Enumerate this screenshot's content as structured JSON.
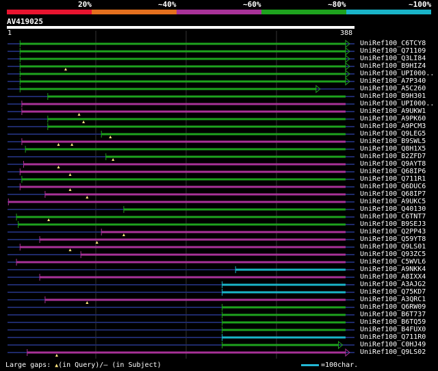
{
  "legend": {
    "labels": [
      "20%",
      "~40%",
      "~60%",
      "~80%",
      "~100%"
    ],
    "colors": [
      "#e8142f",
      "#e36f1e",
      "#a83298",
      "#1ea21e",
      "#1ab4c8"
    ]
  },
  "query": {
    "id": "AV419025",
    "start_label": "1",
    "end_label": "388",
    "length": 388
  },
  "colors": {
    "identity_40_60": "#a83298",
    "identity_60_80": "#1ea21e",
    "identity_80_100": "#1ab4c8",
    "unaligned": "#1e2a6a",
    "gap_marker": "#ffe680",
    "grid": "#333333"
  },
  "hits": [
    {
      "name": "UniRef100_C6TCY8",
      "start": 14,
      "end": 378,
      "color": "green",
      "arrow": true,
      "gaps": []
    },
    {
      "name": "UniRef100_Q71109",
      "start": 14,
      "end": 378,
      "color": "green",
      "arrow": true,
      "gaps": []
    },
    {
      "name": "UniRef100_Q3LI84",
      "start": 14,
      "end": 378,
      "color": "green",
      "arrow": true,
      "gaps": []
    },
    {
      "name": "UniRef100_B9HIZ4",
      "start": 14,
      "end": 378,
      "color": "green",
      "arrow": true,
      "gaps": [
        65
      ]
    },
    {
      "name": "UniRef100_UPI000..",
      "start": 14,
      "end": 378,
      "color": "green",
      "arrow": true,
      "gaps": []
    },
    {
      "name": "UniRef100_A7P340",
      "start": 14,
      "end": 378,
      "color": "green",
      "arrow": true,
      "gaps": []
    },
    {
      "name": "UniRef100_A5C260",
      "start": 14,
      "end": 345,
      "color": "green",
      "arrow": true,
      "gaps": []
    },
    {
      "name": "UniRef100_B9H301",
      "start": 45,
      "end": 378,
      "color": "green",
      "arrow": false,
      "gaps": []
    },
    {
      "name": "UniRef100_UPI000..",
      "start": 16,
      "end": 378,
      "color": "purple",
      "arrow": false,
      "gaps": []
    },
    {
      "name": "UniRef100_A9UKW1",
      "start": 16,
      "end": 378,
      "color": "purple",
      "arrow": false,
      "gaps": [
        80
      ]
    },
    {
      "name": "UniRef100_A9PK60",
      "start": 45,
      "end": 378,
      "color": "green",
      "arrow": false,
      "gaps": [
        85
      ]
    },
    {
      "name": "UniRef100_A9PCM3",
      "start": 45,
      "end": 378,
      "color": "green",
      "arrow": false,
      "gaps": []
    },
    {
      "name": "UniRef100_Q9LEG5",
      "start": 105,
      "end": 378,
      "color": "green",
      "arrow": false,
      "gaps": [
        115
      ]
    },
    {
      "name": "UniRef100_B9SWL5",
      "start": 16,
      "end": 378,
      "color": "purple",
      "arrow": false,
      "gaps": [
        57,
        72
      ]
    },
    {
      "name": "UniRef100_Q8H1X5",
      "start": 20,
      "end": 378,
      "color": "green",
      "arrow": false,
      "gaps": []
    },
    {
      "name": "UniRef100_B2ZFD7",
      "start": 110,
      "end": 378,
      "color": "green",
      "arrow": false,
      "gaps": [
        118
      ]
    },
    {
      "name": "UniRef100_Q9AYT8",
      "start": 18,
      "end": 378,
      "color": "purple",
      "arrow": false,
      "gaps": [
        57
      ]
    },
    {
      "name": "UniRef100_Q68IP6",
      "start": 14,
      "end": 378,
      "color": "purple",
      "arrow": false,
      "gaps": [
        70
      ]
    },
    {
      "name": "UniRef100_Q711R1",
      "start": 16,
      "end": 378,
      "color": "green",
      "arrow": false,
      "gaps": []
    },
    {
      "name": "UniRef100_Q6DUC6",
      "start": 14,
      "end": 378,
      "color": "purple",
      "arrow": false,
      "gaps": [
        70
      ]
    },
    {
      "name": "UniRef100_Q68IP7",
      "start": 42,
      "end": 378,
      "color": "purple",
      "arrow": false,
      "gaps": [
        89
      ]
    },
    {
      "name": "UniRef100_A9UKC5",
      "start": 1,
      "end": 378,
      "color": "purple",
      "arrow": false,
      "gaps": []
    },
    {
      "name": "UniRef100_Q40130",
      "start": 130,
      "end": 378,
      "color": "green",
      "arrow": false,
      "gaps": []
    },
    {
      "name": "UniRef100_C6TNT7",
      "start": 10,
      "end": 378,
      "color": "green",
      "arrow": false,
      "gaps": [
        46
      ]
    },
    {
      "name": "UniRef100_B9SEJ3",
      "start": 12,
      "end": 378,
      "color": "green",
      "arrow": false,
      "gaps": []
    },
    {
      "name": "UniRef100_Q2PP43",
      "start": 105,
      "end": 378,
      "color": "purple",
      "arrow": false,
      "gaps": [
        130
      ]
    },
    {
      "name": "UniRef100_Q59YT8",
      "start": 36,
      "end": 378,
      "color": "purple",
      "arrow": false,
      "gaps": [
        100
      ]
    },
    {
      "name": "UniRef100_Q9LS01",
      "start": 14,
      "end": 378,
      "color": "purple",
      "arrow": false,
      "gaps": [
        70
      ]
    },
    {
      "name": "UniRef100_Q93ZC5",
      "start": 82,
      "end": 378,
      "color": "purple",
      "arrow": false,
      "gaps": []
    },
    {
      "name": "UniRef100_C5WVL6",
      "start": 10,
      "end": 378,
      "color": "purple",
      "arrow": false,
      "gaps": []
    },
    {
      "name": "UniRef100_A9NKK4",
      "start": 255,
      "end": 378,
      "color": "cyan",
      "arrow": false,
      "gaps": []
    },
    {
      "name": "UniRef100_A8IXX4",
      "start": 36,
      "end": 378,
      "color": "purple",
      "arrow": false,
      "gaps": []
    },
    {
      "name": "UniRef100_A3AJG2",
      "start": 240,
      "end": 378,
      "color": "cyan",
      "arrow": false,
      "gaps": []
    },
    {
      "name": "UniRef100_Q75KD7",
      "start": 240,
      "end": 378,
      "color": "cyan",
      "arrow": false,
      "gaps": []
    },
    {
      "name": "UniRef100_A3QRC1",
      "start": 42,
      "end": 378,
      "color": "purple",
      "arrow": false,
      "gaps": [
        89
      ]
    },
    {
      "name": "UniRef100_Q6RW09",
      "start": 240,
      "end": 378,
      "color": "green",
      "arrow": false,
      "gaps": []
    },
    {
      "name": "UniRef100_B6T737",
      "start": 240,
      "end": 378,
      "color": "green",
      "arrow": false,
      "gaps": []
    },
    {
      "name": "UniRef100_B6TQ59",
      "start": 240,
      "end": 378,
      "color": "green",
      "arrow": false,
      "gaps": []
    },
    {
      "name": "UniRef100_B4FUX0",
      "start": 240,
      "end": 378,
      "color": "green",
      "arrow": false,
      "gaps": []
    },
    {
      "name": "UniRef100_Q711R0",
      "start": 240,
      "end": 378,
      "color": "cyan",
      "arrow": false,
      "gaps": []
    },
    {
      "name": "UniRef100_C0HJ49",
      "start": 240,
      "end": 370,
      "color": "green",
      "arrow": true,
      "gaps": []
    },
    {
      "name": "UniRef100_Q9LS02",
      "start": 22,
      "end": 378,
      "color": "purple",
      "arrow": true,
      "gaps": [
        55
      ]
    }
  ],
  "footer": {
    "text": "Large gaps: ",
    "query_gap_label": "(in Query)",
    "separator": "/",
    "subject_gap_marker": "–",
    "subject_gap_label": " (in Subject)",
    "scale_label": "=100char."
  }
}
